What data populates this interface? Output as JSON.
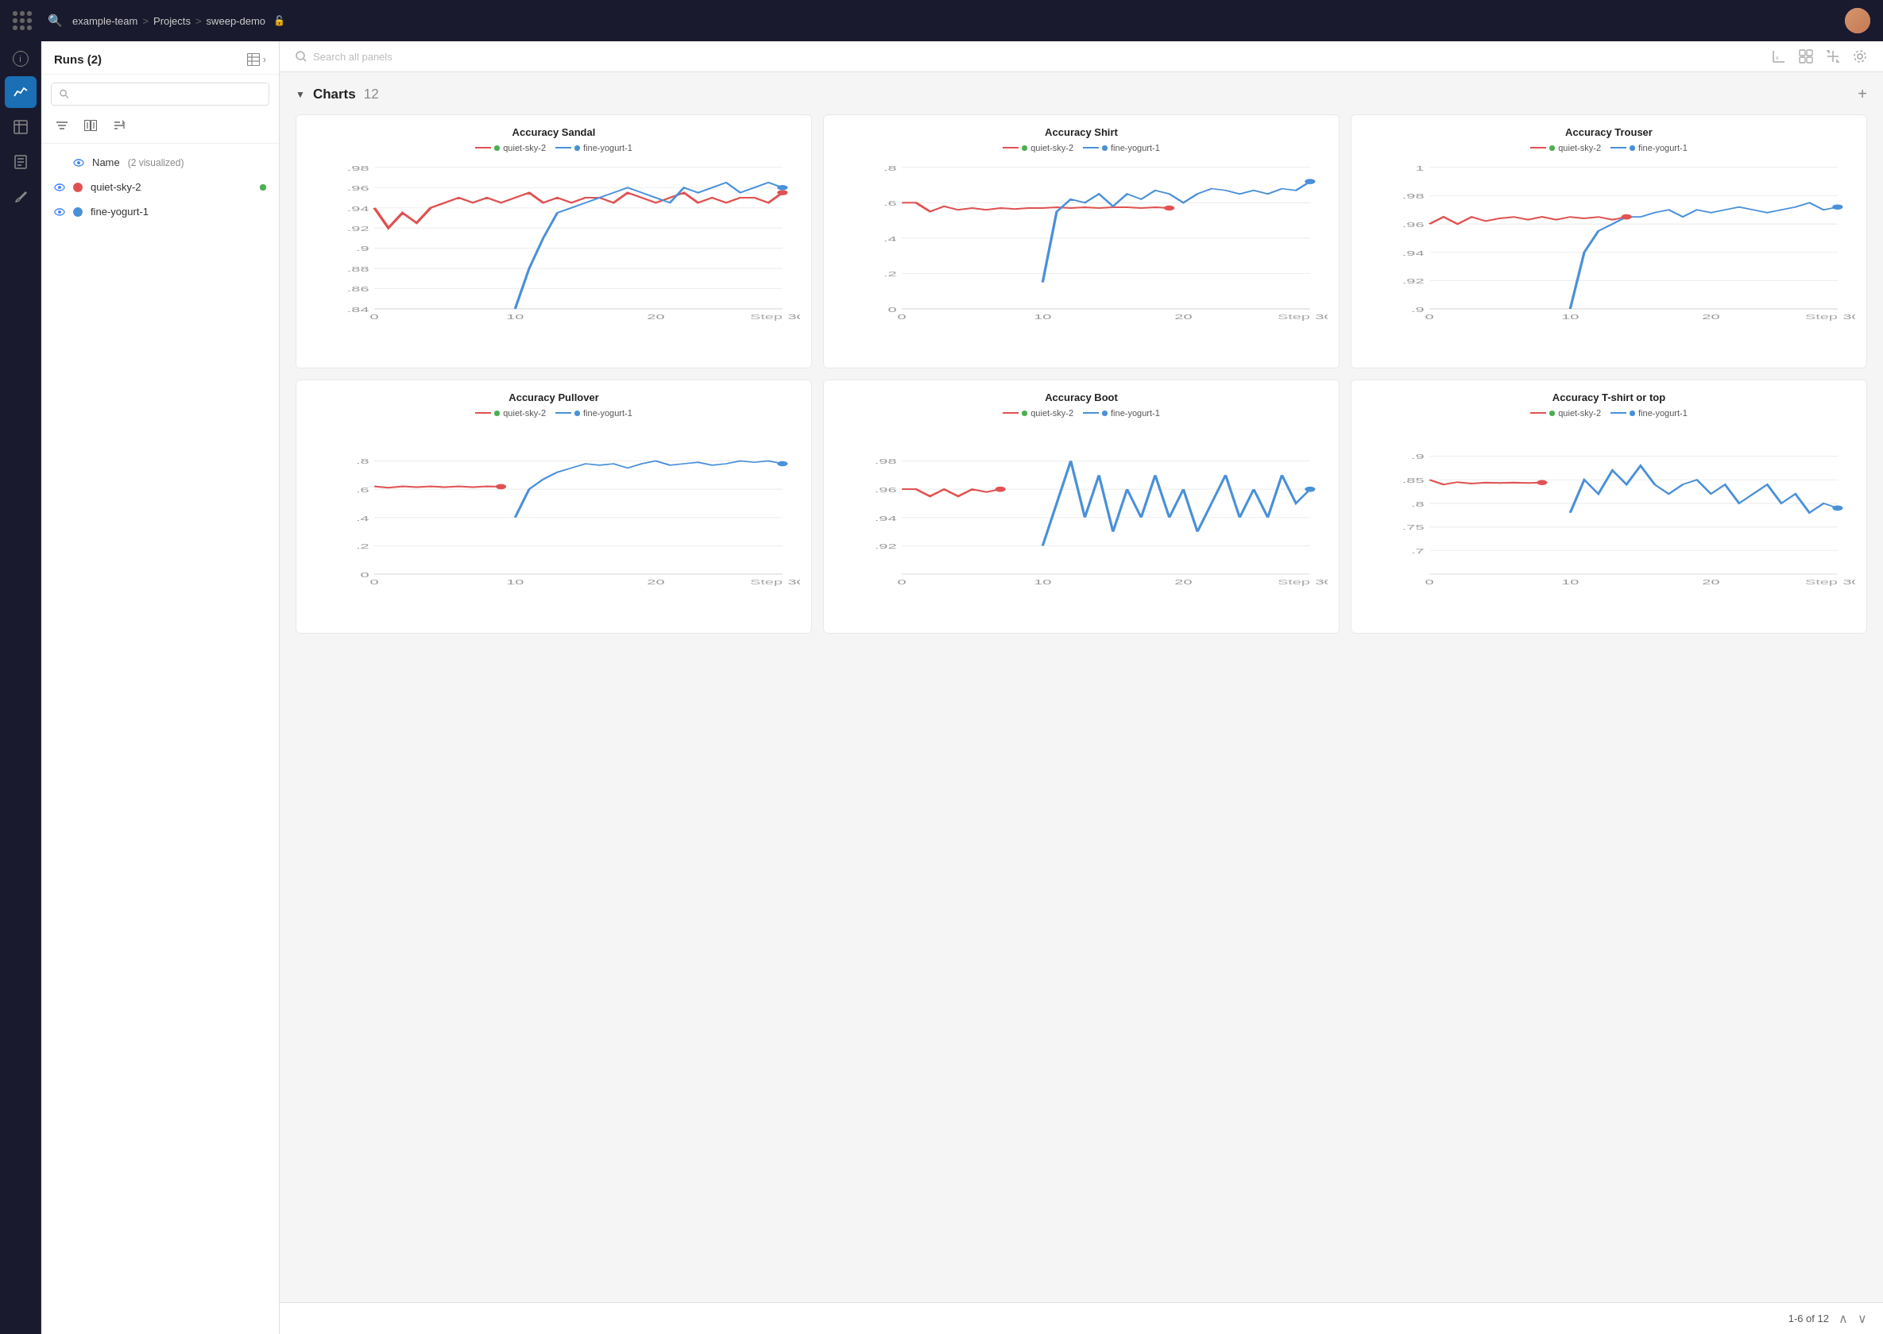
{
  "nav": {
    "breadcrumb": [
      "example-team",
      "Projects",
      "sweep-demo"
    ],
    "search_placeholder": "Search"
  },
  "sidebar_icons": [
    {
      "name": "info-icon",
      "symbol": "ℹ",
      "active": false
    },
    {
      "name": "chart-icon",
      "symbol": "📈",
      "active": true
    },
    {
      "name": "table-icon",
      "symbol": "⊞",
      "active": false
    },
    {
      "name": "notes-icon",
      "symbol": "📋",
      "active": false
    },
    {
      "name": "brush-icon",
      "symbol": "🖌",
      "active": false
    }
  ],
  "runs_panel": {
    "title": "Runs (2)",
    "search_placeholder": "",
    "name_label": "Name",
    "vis_count": "(2 visualized)",
    "runs": [
      {
        "name": "quiet-sky-2",
        "color": "#e05252",
        "status_color": "#4caf50"
      },
      {
        "name": "fine-yogurt-1",
        "color": "#4a90d9",
        "status_color": null
      }
    ]
  },
  "toolbar": {
    "search_placeholder": "Search all panels"
  },
  "charts_section": {
    "title": "Charts",
    "count": "12",
    "add_label": "+"
  },
  "pagination": {
    "text": "1-6 of 12"
  },
  "charts": [
    {
      "id": "accuracy-sandal",
      "title": "Accuracy Sandal",
      "ymin": 0.84,
      "ymax": 0.98,
      "yticks": [
        0.84,
        0.86,
        0.88,
        0.9,
        0.92,
        0.94,
        0.96,
        0.98
      ],
      "series_red": [
        0.94,
        0.92,
        0.935,
        0.925,
        0.94,
        0.945,
        0.95,
        0.945,
        0.95,
        0.945,
        0.95,
        0.955,
        0.945,
        0.95,
        0.945,
        0.95,
        0.95,
        0.945,
        0.955,
        0.95,
        0.945,
        0.95,
        0.955,
        0.945,
        0.95,
        0.945,
        0.95,
        0.95,
        0.945,
        0.955
      ],
      "series_blue": [
        null,
        null,
        null,
        null,
        null,
        null,
        null,
        null,
        null,
        null,
        0.84,
        0.88,
        0.91,
        0.935,
        0.94,
        0.945,
        0.95,
        0.955,
        0.96,
        0.955,
        0.95,
        0.945,
        0.96,
        0.955,
        0.96,
        0.965,
        0.955,
        0.96,
        0.965,
        0.96
      ]
    },
    {
      "id": "accuracy-shirt",
      "title": "Accuracy Shirt",
      "ymin": 0,
      "ymax": 0.8,
      "yticks": [
        0,
        0.2,
        0.4,
        0.6,
        0.8
      ],
      "series_red": [
        0.6,
        0.6,
        0.55,
        0.58,
        0.56,
        0.57,
        0.56,
        0.57,
        0.565,
        0.57,
        0.57,
        0.575,
        0.57,
        0.575,
        0.57,
        0.575,
        0.575,
        0.57,
        0.575,
        0.57
      ],
      "series_blue": [
        null,
        null,
        null,
        null,
        null,
        null,
        null,
        null,
        null,
        null,
        0.15,
        0.55,
        0.62,
        0.6,
        0.65,
        0.58,
        0.65,
        0.62,
        0.67,
        0.65,
        0.6,
        0.65,
        0.68,
        0.67,
        0.65,
        0.67,
        0.65,
        0.68,
        0.67,
        0.72
      ]
    },
    {
      "id": "accuracy-trouser",
      "title": "Accuracy Trouser",
      "ymin": 0.9,
      "ymax": 1.0,
      "yticks": [
        0.9,
        0.92,
        0.94,
        0.96,
        0.98,
        1.0
      ],
      "series_red": [
        0.96,
        0.965,
        0.96,
        0.965,
        0.962,
        0.964,
        0.965,
        0.963,
        0.965,
        0.963,
        0.965,
        0.964,
        0.965,
        0.963,
        0.965
      ],
      "series_blue": [
        null,
        null,
        null,
        null,
        null,
        null,
        null,
        null,
        null,
        null,
        0.9,
        0.94,
        0.955,
        0.96,
        0.965,
        0.965,
        0.968,
        0.97,
        0.965,
        0.97,
        0.968,
        0.97,
        0.972,
        0.97,
        0.968,
        0.97,
        0.972,
        0.975,
        0.97,
        0.972
      ]
    },
    {
      "id": "accuracy-pullover",
      "title": "Accuracy Pullover",
      "ymin": 0,
      "ymax": 1.0,
      "yticks": [
        0,
        0.2,
        0.4,
        0.6,
        0.8
      ],
      "series_red": [
        0.62,
        0.61,
        0.62,
        0.615,
        0.62,
        0.615,
        0.62,
        0.615,
        0.62,
        0.618
      ],
      "series_blue": [
        null,
        null,
        null,
        null,
        null,
        null,
        null,
        null,
        null,
        null,
        0.4,
        0.6,
        0.67,
        0.72,
        0.75,
        0.78,
        0.77,
        0.78,
        0.75,
        0.78,
        0.8,
        0.77,
        0.78,
        0.79,
        0.77,
        0.78,
        0.8,
        0.79,
        0.8,
        0.78
      ]
    },
    {
      "id": "accuracy-boot",
      "title": "Accuracy Boot",
      "ymin": 0.9,
      "ymax": 1.0,
      "yticks": [
        0.92,
        0.94,
        0.96,
        0.98
      ],
      "series_red": [
        0.96,
        0.96,
        0.955,
        0.96,
        0.955,
        0.96,
        0.958,
        0.96
      ],
      "series_blue": [
        null,
        null,
        null,
        null,
        null,
        null,
        null,
        null,
        null,
        null,
        0.92,
        0.95,
        0.98,
        0.94,
        0.97,
        0.93,
        0.96,
        0.94,
        0.97,
        0.94,
        0.96,
        0.93,
        0.95,
        0.97,
        0.94,
        0.96,
        0.94,
        0.97,
        0.95,
        0.96
      ]
    },
    {
      "id": "accuracy-tshirt",
      "title": "Accuracy T-shirt or top",
      "ymin": 0.65,
      "ymax": 0.95,
      "yticks": [
        0.7,
        0.75,
        0.8,
        0.85,
        0.9
      ],
      "series_red": [
        0.85,
        0.84,
        0.845,
        0.842,
        0.844,
        0.843,
        0.844,
        0.843,
        0.844
      ],
      "series_blue": [
        null,
        null,
        null,
        null,
        null,
        null,
        null,
        null,
        null,
        null,
        0.78,
        0.85,
        0.82,
        0.87,
        0.84,
        0.88,
        0.84,
        0.82,
        0.84,
        0.85,
        0.82,
        0.84,
        0.8,
        0.82,
        0.84,
        0.8,
        0.82,
        0.78,
        0.8,
        0.79
      ]
    }
  ]
}
